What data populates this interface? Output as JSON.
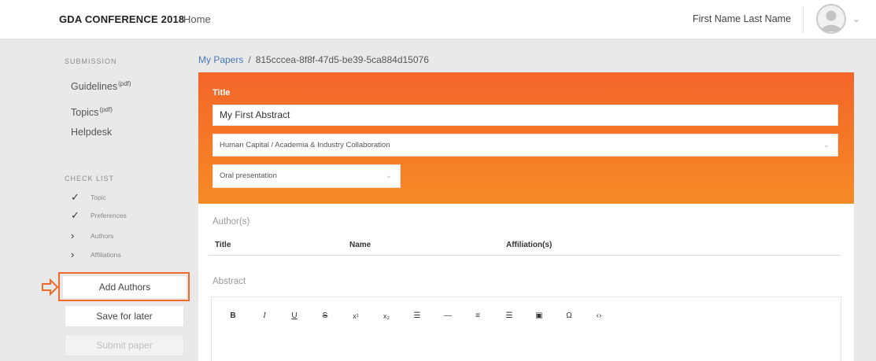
{
  "header": {
    "brand": "GDA CONFERENCE 2018",
    "home_label": "Home",
    "user_name": "First Name Last Name",
    "caret": "⌄"
  },
  "sidebar": {
    "submission_label": "SUBMISSION",
    "links": [
      {
        "label": "Guidelines",
        "sup": "(pdf)"
      },
      {
        "label": "Topics",
        "sup": "(pdf)"
      },
      {
        "label": "Helpdesk",
        "sup": ""
      }
    ],
    "checklist_label": "CHECK LIST",
    "checklist": [
      {
        "label": "Topic",
        "mark": "✓",
        "state": "done"
      },
      {
        "label": "Preferences",
        "mark": "✓",
        "state": "done"
      },
      {
        "label": "Authors",
        "mark": "›",
        "state": "pending"
      },
      {
        "label": "Affiliations",
        "mark": "›",
        "state": "pending"
      }
    ],
    "add_authors_label": "Add Authors",
    "save_label": "Save for later",
    "submit_label": "Submit paper",
    "accent_color": "#f26a2b"
  },
  "breadcrumb": {
    "root": "My Papers",
    "separator": "/",
    "current": "815cccea-8f8f-47d5-be39-5ca884d15076"
  },
  "form": {
    "title_label": "Title",
    "title_value": "My First Abstract",
    "topic_value": "Human Capital / Academia & Industry Collaboration",
    "presentation_value": "Oral presentation",
    "chevron": "⌄",
    "authors_label": "Author(s)",
    "author_columns": [
      "Title",
      "Name",
      "Affiliation(s)"
    ],
    "abstract_label": "Abstract",
    "header_gradient": [
      "#f4652a",
      "#f68a25"
    ]
  },
  "toolbar": [
    {
      "icon": "bold-icon",
      "glyph": "B"
    },
    {
      "icon": "italic-icon",
      "glyph": "I"
    },
    {
      "icon": "underline-icon",
      "glyph": "U"
    },
    {
      "icon": "strikethrough-icon",
      "glyph": "S"
    },
    {
      "icon": "superscript-icon",
      "glyph": "x¹"
    },
    {
      "icon": "subscript-icon",
      "glyph": "x₂"
    },
    {
      "icon": "bulleted-list-icon",
      "glyph": "☰"
    },
    {
      "icon": "horizontal-rule-icon",
      "glyph": "—"
    },
    {
      "icon": "align-icon",
      "glyph": "≡"
    },
    {
      "icon": "numbered-list-icon",
      "glyph": "☰"
    },
    {
      "icon": "image-icon",
      "glyph": "▣"
    },
    {
      "icon": "special-character-icon",
      "glyph": "Ω"
    },
    {
      "icon": "source-code-icon",
      "glyph": "‹›"
    }
  ]
}
